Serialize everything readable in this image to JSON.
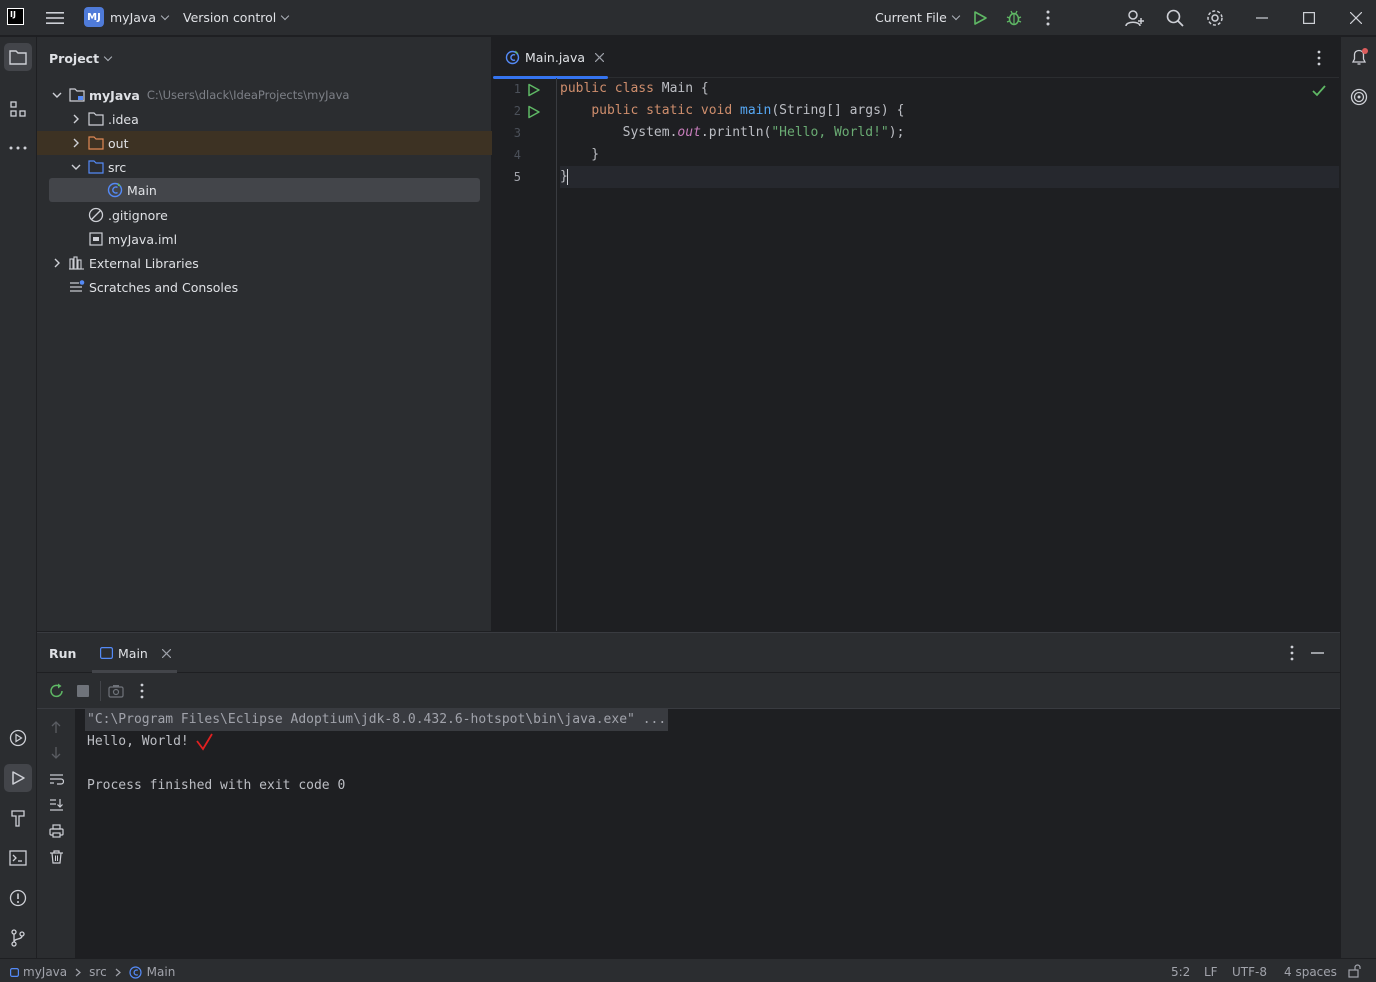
{
  "titlebar": {
    "logo_text": "IJ",
    "project_badge": "MJ",
    "project_name": "myJava",
    "vcs_label": "Version control",
    "run_config": "Current File"
  },
  "project_panel": {
    "title": "Project",
    "root_name": "myJava",
    "root_path": "C:\\Users\\dlack\\IdeaProjects\\myJava",
    "items": [
      {
        "label": ".idea"
      },
      {
        "label": "out"
      },
      {
        "label": "src"
      },
      {
        "label": "Main"
      },
      {
        "label": ".gitignore"
      },
      {
        "label": "myJava.iml"
      },
      {
        "label": "External Libraries"
      },
      {
        "label": "Scratches and Consoles"
      }
    ]
  },
  "editor": {
    "tab_label": "Main.java",
    "line_numbers": [
      "1",
      "2",
      "3",
      "4",
      "5"
    ],
    "code": {
      "l1_kw": "public class ",
      "l1_name": "Main {",
      "l2_indent": "    ",
      "l2_kw": "public static void ",
      "l2_fn": "main",
      "l2_rest": "(String[] args) {",
      "l3_indent": "        ",
      "l3_sys": "System.",
      "l3_fld": "out",
      "l3_call": ".println(",
      "l3_str": "\"Hello, World!\"",
      "l3_end": ");",
      "l4": "    }",
      "l5": "}"
    }
  },
  "run_panel": {
    "title": "Run",
    "tab_label": "Main",
    "console": {
      "command": "\"C:\\Program Files\\Eclipse Adoptium\\jdk-8.0.432.6-hotspot\\bin\\java.exe\" ...",
      "output": "Hello, World!",
      "exit": "Process finished with exit code 0"
    }
  },
  "statusbar": {
    "crumb_project": "myJava",
    "crumb_src": "src",
    "crumb_main": "Main",
    "position": "5:2",
    "line_sep": "LF",
    "encoding": "UTF-8",
    "indent": "4 spaces"
  },
  "colors": {
    "accent": "#3574f0",
    "run_green": "#5fb865",
    "keyword": "#cf8e6d",
    "string": "#6aab73",
    "function": "#56a8f5",
    "field": "#c77dbb"
  }
}
